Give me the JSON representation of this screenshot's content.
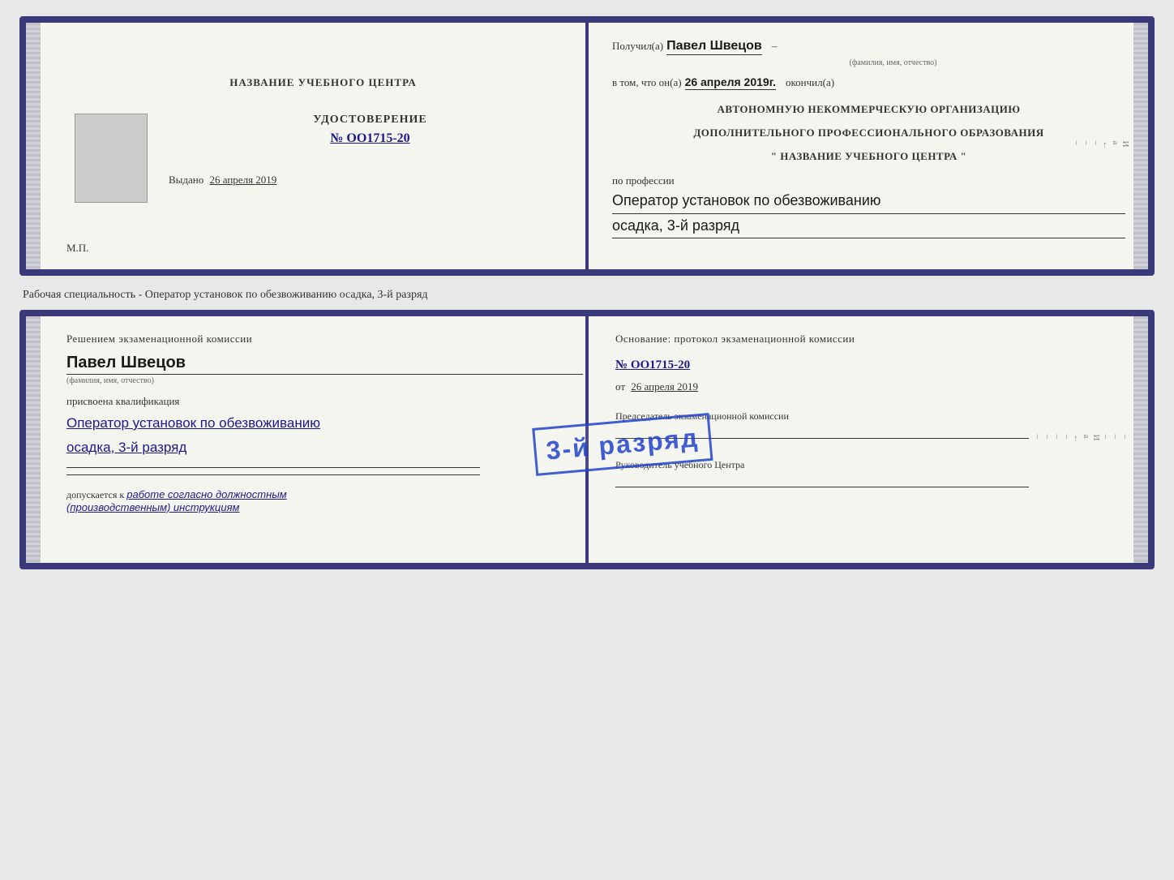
{
  "page": {
    "background_label": "Рабочая специальность - Оператор установок по обезвоживанию осадка, 3-й разряд"
  },
  "card1": {
    "left": {
      "center_title": "НАЗВАНИЕ УЧЕБНОГО ЦЕНТРА",
      "cert_title": "УДОСТОВЕРЕНИЕ",
      "cert_number": "№ OO1715-20",
      "issued_label": "Выдано",
      "issued_date": "26 апреля 2019",
      "mp_label": "М.П."
    },
    "right": {
      "received_prefix": "Получил(а)",
      "name_handwritten": "Павел Швецов",
      "name_subtitle": "(фамилия, имя, отчество)",
      "dash1": "–",
      "in_that_prefix": "в том, что он(а)",
      "date_handwritten": "26 апреля 2019г.",
      "finished_label": "окончил(а)",
      "org_line1": "АВТОНОМНУЮ НЕКОММЕРЧЕСКУЮ ОРГАНИЗАЦИЮ",
      "org_line2": "ДОПОЛНИТЕЛЬНОГО ПРОФЕССИОНАЛЬНОГО ОБРАЗОВАНИЯ",
      "org_line3": "\"  НАЗВАНИЕ УЧЕБНОГО ЦЕНТРА  \"",
      "profession_prefix": "по профессии",
      "profession_value": "Оператор установок по обезвоживанию",
      "profession_value2": "осадка, 3-й разряд",
      "side_chars": "И а ←"
    }
  },
  "between": {
    "label": "Рабочая специальность - Оператор установок по обезвоживанию осадка, 3-й разряд"
  },
  "card2": {
    "left": {
      "decision_title": "Решением экзаменационной комиссии",
      "name_handwritten": "Павел Швецов",
      "name_subtitle": "(фамилия, имя, отчество)",
      "assigned_label": "присвоена квалификация",
      "qualification1": "Оператор установок по обезвоживанию",
      "qualification2": "осадка, 3-й разряд",
      "allowed_prefix": "допускается к",
      "allowed_value": "работе согласно должностным",
      "allowed_value2": "(производственным) инструкциям"
    },
    "right": {
      "basis_title": "Основание: протокол экзаменационной комиссии",
      "protocol_number": "№ OO1715-20",
      "date_prefix": "от",
      "date_value": "26 апреля 2019",
      "chairman_label": "Председатель экзаменационной комиссии",
      "director_label": "Руководитель учебного Центра",
      "side_chars": "И а ←"
    },
    "stamp": {
      "text": "3-й разряд"
    }
  }
}
